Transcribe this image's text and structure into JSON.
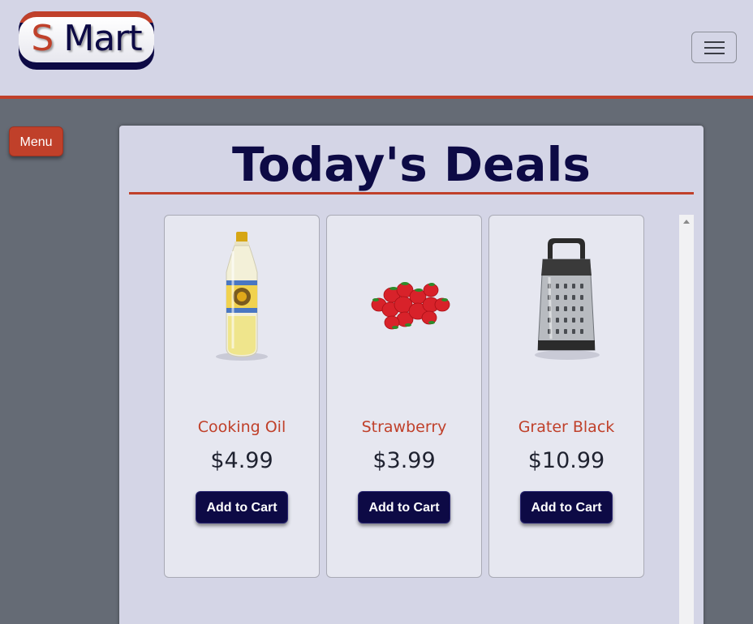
{
  "header": {
    "logo": {
      "letter": "S",
      "word": "Mart"
    },
    "nav_toggle_icon": "hamburger-icon"
  },
  "sidebar": {
    "menu_label": "Menu"
  },
  "main": {
    "title": "Today's Deals",
    "products": [
      {
        "name": "Cooking Oil",
        "price": "$4.99",
        "button_label": "Add to Cart",
        "image": "cooking-oil-bottle"
      },
      {
        "name": "Strawberry",
        "price": "$3.99",
        "button_label": "Add to Cart",
        "image": "strawberries"
      },
      {
        "name": "Grater Black",
        "price": "$10.99",
        "button_label": "Add to Cart",
        "image": "box-grater"
      }
    ]
  },
  "colors": {
    "brand_red": "#c0402a",
    "brand_navy": "#0d0a45",
    "header_bg": "#d4d5e6",
    "page_bg": "#656b75"
  }
}
